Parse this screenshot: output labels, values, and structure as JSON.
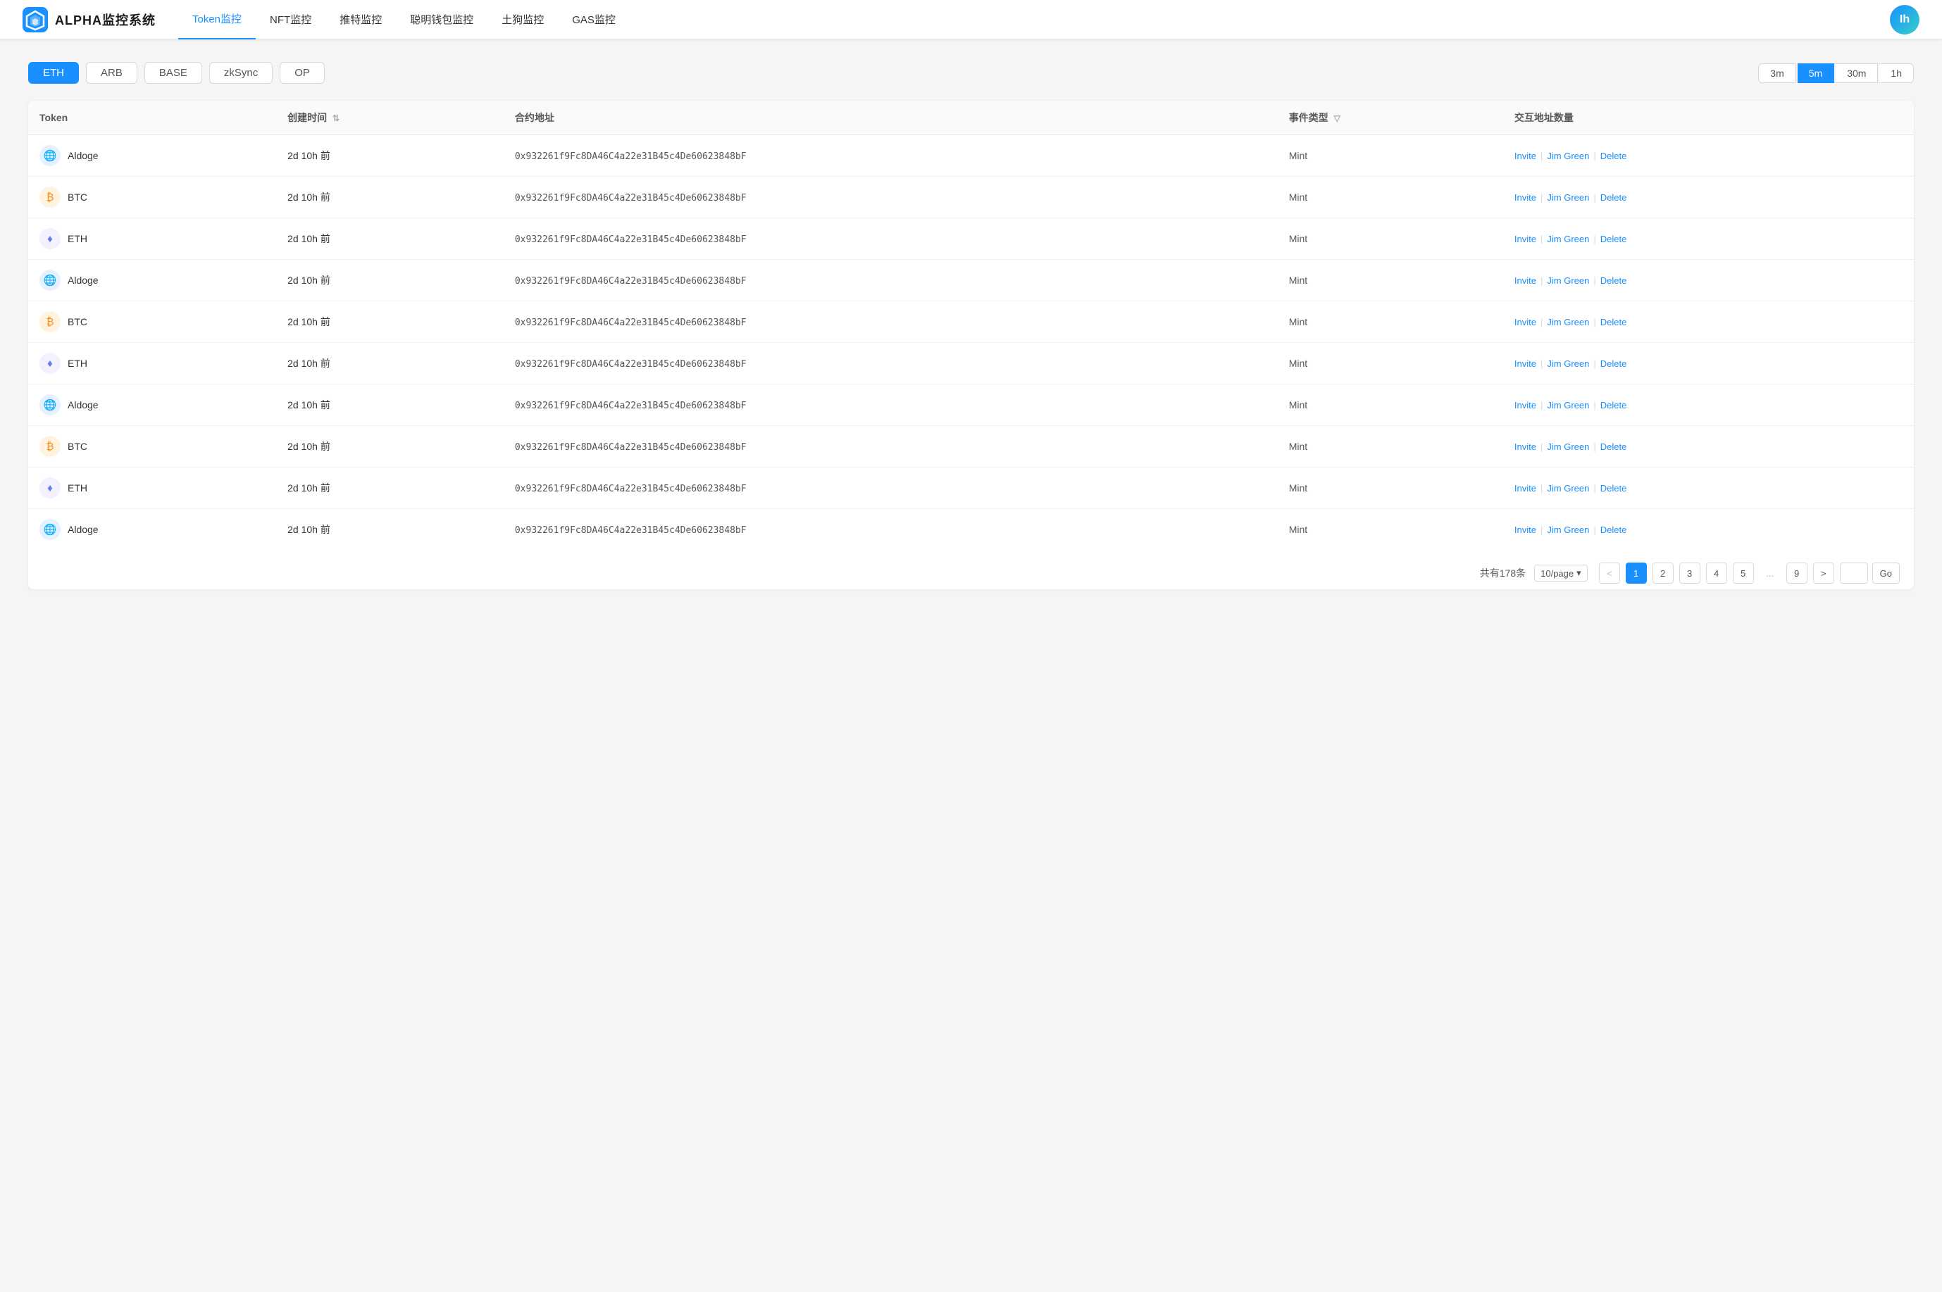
{
  "app": {
    "title": "ALPHA监控系统",
    "avatar_text": "Ih"
  },
  "nav": {
    "items": [
      {
        "label": "Token监控",
        "active": true
      },
      {
        "label": "NFT监控",
        "active": false
      },
      {
        "label": "推特监控",
        "active": false
      },
      {
        "label": "聪明钱包监控",
        "active": false
      },
      {
        "label": "土狗监控",
        "active": false
      },
      {
        "label": "GAS监控",
        "active": false
      }
    ]
  },
  "chains": {
    "items": [
      {
        "label": "ETH",
        "active": true
      },
      {
        "label": "ARB",
        "active": false
      },
      {
        "label": "BASE",
        "active": false
      },
      {
        "label": "zkSync",
        "active": false
      },
      {
        "label": "OP",
        "active": false
      }
    ]
  },
  "time_filters": {
    "items": [
      {
        "label": "3m",
        "active": false
      },
      {
        "label": "5m",
        "active": true
      },
      {
        "label": "30m",
        "active": false
      },
      {
        "label": "1h",
        "active": false
      }
    ]
  },
  "table": {
    "columns": [
      {
        "label": "Token",
        "key": "token"
      },
      {
        "label": "创建时间",
        "key": "created_time",
        "sortable": true
      },
      {
        "label": "合约地址",
        "key": "contract"
      },
      {
        "label": "事件类型",
        "key": "event_type",
        "filterable": true
      },
      {
        "label": "交互地址数量",
        "key": "actions"
      }
    ],
    "rows": [
      {
        "icon": "aldoge",
        "token": "Aldoge",
        "created_time": "2d 10h 前",
        "contract": "0x932261f9Fc8DA46C4a22e31B45c4De60623848bF",
        "event_type": "Mint",
        "invite": "Invite",
        "jimgreen": "Jim Green",
        "delete": "Delete"
      },
      {
        "icon": "btc",
        "token": "BTC",
        "created_time": "2d 10h 前",
        "contract": "0x932261f9Fc8DA46C4a22e31B45c4De60623848bF",
        "event_type": "Mint",
        "invite": "Invite",
        "jimgreen": "Jim Green",
        "delete": "Delete"
      },
      {
        "icon": "eth",
        "token": "ETH",
        "created_time": "2d 10h 前",
        "contract": "0x932261f9Fc8DA46C4a22e31B45c4De60623848bF",
        "event_type": "Mint",
        "invite": "Invite",
        "jimgreen": "Jim Green",
        "delete": "Delete"
      },
      {
        "icon": "aldoge",
        "token": "Aldoge",
        "created_time": "2d 10h 前",
        "contract": "0x932261f9Fc8DA46C4a22e31B45c4De60623848bF",
        "event_type": "Mint",
        "invite": "Invite",
        "jimgreen": "Jim Green",
        "delete": "Delete"
      },
      {
        "icon": "btc",
        "token": "BTC",
        "created_time": "2d 10h 前",
        "contract": "0x932261f9Fc8DA46C4a22e31B45c4De60623848bF",
        "event_type": "Mint",
        "invite": "Invite",
        "jimgreen": "Jim Green",
        "delete": "Delete"
      },
      {
        "icon": "eth",
        "token": "ETH",
        "created_time": "2d 10h 前",
        "contract": "0x932261f9Fc8DA46C4a22e31B45c4De60623848bF",
        "event_type": "Mint",
        "invite": "Invite",
        "jimgreen": "Jim Green",
        "delete": "Delete"
      },
      {
        "icon": "aldoge",
        "token": "Aldoge",
        "created_time": "2d 10h 前",
        "contract": "0x932261f9Fc8DA46C4a22e31B45c4De60623848bF",
        "event_type": "Mint",
        "invite": "Invite",
        "jimgreen": "Jim Green",
        "delete": "Delete"
      },
      {
        "icon": "btc",
        "token": "BTC",
        "created_time": "2d 10h 前",
        "contract": "0x932261f9Fc8DA46C4a22e31B45c4De60623848bF",
        "event_type": "Mint",
        "invite": "Invite",
        "jimgreen": "Jim Green",
        "delete": "Delete"
      },
      {
        "icon": "eth",
        "token": "ETH",
        "created_time": "2d 10h 前",
        "contract": "0x932261f9Fc8DA46C4a22e31B45c4De60623848bF",
        "event_type": "Mint",
        "invite": "Invite",
        "jimgreen": "Jim Green",
        "delete": "Delete"
      },
      {
        "icon": "aldoge",
        "token": "Aldoge",
        "created_time": "2d 10h 前",
        "contract": "0x932261f9Fc8DA46C4a22e31B45c4De60623848bF",
        "event_type": "Mint",
        "invite": "Invite",
        "jimgreen": "Jim Green",
        "delete": "Delete"
      }
    ]
  },
  "pagination": {
    "total_text": "共有178条",
    "page_size": "10/page",
    "prev": "<",
    "next": ">",
    "pages": [
      "1",
      "2",
      "3",
      "4",
      "5"
    ],
    "dots": "...",
    "go_label": "Go",
    "last_page": "9",
    "current_page": "1"
  },
  "icons": {
    "aldoge_emoji": "🌐",
    "btc_emoji": "₿",
    "eth_emoji": "♦"
  }
}
